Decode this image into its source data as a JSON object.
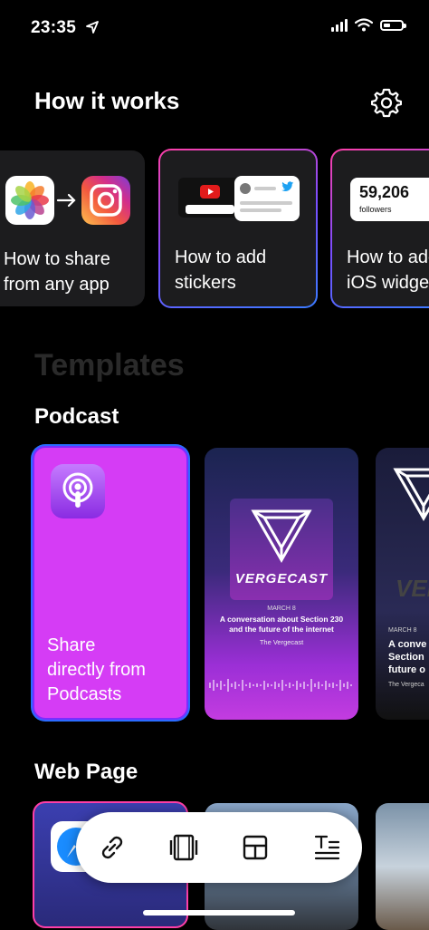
{
  "status_bar": {
    "time": "23:35",
    "battery_level": 0.35
  },
  "header": {
    "title": "How it works",
    "settings_icon": "gear-icon"
  },
  "how_it_works": [
    {
      "label_line1": "How to share",
      "label_line2": "from any app"
    },
    {
      "label_line1": "How to add",
      "label_line2": "stickers"
    },
    {
      "label_line1": "How to add",
      "label_line2": "iOS widge",
      "followers_count": "59,206",
      "followers_label": "followers"
    }
  ],
  "templates_heading": "Templates",
  "podcast": {
    "title": "Podcast",
    "share_card": {
      "line1": "Share",
      "line2": "directly from",
      "line3": "Podcasts"
    },
    "vergecast_card": {
      "brand": "VERGECAST",
      "date": "MARCH 8",
      "headline_line1": "A conversation about Section 230",
      "headline_line2": "and the future of the internet",
      "source": "The Vergecast"
    },
    "vergecast_card_2": {
      "brand": "VER",
      "date": "MARCH 8",
      "headline_line1": "A conve",
      "headline_line2": "Section",
      "headline_line3": "future o",
      "source": "The Vergeca"
    }
  },
  "web_page": {
    "title": "Web Page"
  },
  "toolbar": {
    "items": [
      "link-icon",
      "crop-frame-icon",
      "layout-icon",
      "text-format-icon"
    ]
  },
  "colors": {
    "accent_pink": "#ff3fa7",
    "accent_purple": "#d53cf5",
    "accent_blue": "#2b6bff"
  }
}
